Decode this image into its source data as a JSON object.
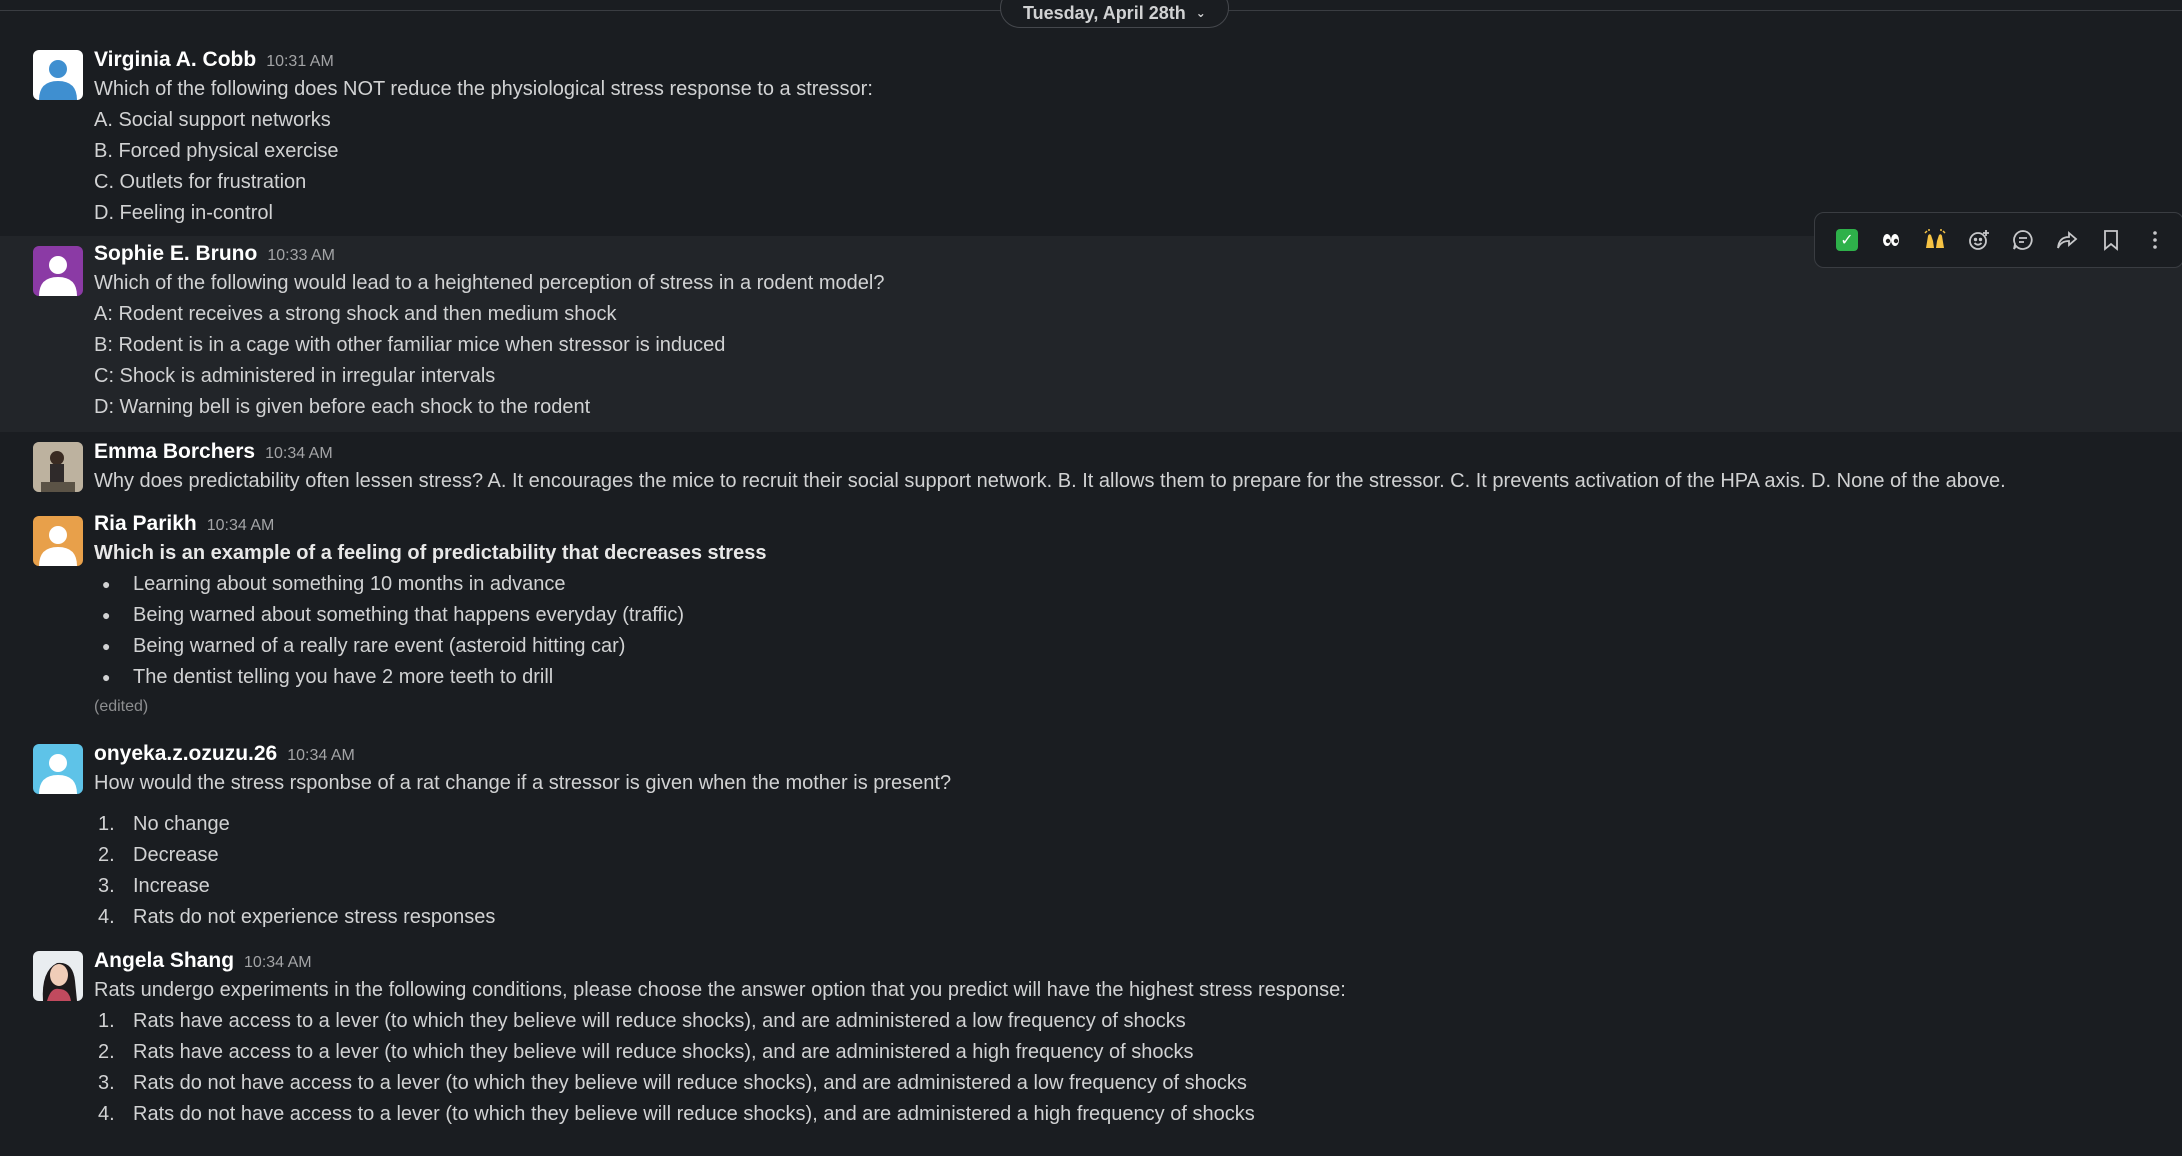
{
  "date_divider": {
    "label": "Tuesday, April 28th"
  },
  "messages": [
    {
      "author": "Virginia A. Cobb",
      "time": "10:31 AM",
      "lines": [
        "Which of the following does NOT reduce the physiological stress response to a stressor:",
        "A. Social support networks",
        "B. Forced physical exercise",
        "C. Outlets for frustration",
        "D. Feeling in-control"
      ]
    },
    {
      "author": "Sophie E. Bruno",
      "time": "10:33 AM",
      "lines": [
        "Which of the following would lead to a heightened perception of stress in a rodent model?",
        "A: Rodent receives a strong shock and then medium shock",
        "B: Rodent is in a cage with other familiar mice when stressor is induced",
        "C: Shock is administered in irregular intervals",
        "D: Warning bell is given before each shock to the rodent"
      ]
    },
    {
      "author": "Emma Borchers",
      "time": "10:34 AM",
      "lines": [
        "Why does predictability often lessen stress? A. It encourages the mice to recruit their social support network. B. It allows them to prepare for the stressor. C. It prevents activation of the HPA axis. D. None of the above."
      ]
    },
    {
      "author": "Ria Parikh",
      "time": "10:34 AM",
      "heading": "Which is an example of a feeling of predictability that decreases stress",
      "bullets": [
        "Learning about something 10 months in advance",
        "Being warned about something that happens everyday (traffic)",
        "Being warned of a really rare event (asteroid hitting car)",
        "The dentist telling you have 2 more teeth to drill"
      ],
      "edited": "(edited)"
    },
    {
      "author": "onyeka.z.ozuzu.26",
      "time": "10:34 AM",
      "lines": [
        "How would the stress rsponbse of a rat change if a stressor is given when the mother is present?"
      ],
      "items": [
        {
          "num": "1.",
          "text": "No change"
        },
        {
          "num": "2.",
          "text": "Decrease"
        },
        {
          "num": "3.",
          "text": "Increase"
        },
        {
          "num": "4.",
          "text": "Rats do not experience stress responses"
        }
      ]
    },
    {
      "author": "Angela Shang",
      "time": "10:34 AM",
      "lines": [
        "Rats undergo experiments in the following conditions, please choose the answer option that you predict will have the highest stress response:"
      ],
      "items": [
        {
          "num": "1.",
          "text": "Rats have access to a lever (to which they believe will reduce shocks), and are administered a low frequency of shocks"
        },
        {
          "num": "2.",
          "text": "Rats have access to a lever (to which they believe will reduce shocks), and are administered a high frequency of shocks"
        },
        {
          "num": "3.",
          "text": "Rats do not have access to a lever (to which they believe will reduce shocks), and are administered a low frequency of shocks"
        },
        {
          "num": "4.",
          "text": "Rats do not have access to a lever (to which they believe will reduce shocks), and are administered a high frequency of shocks"
        }
      ]
    }
  ],
  "toolbar": {
    "buttons": [
      {
        "icon": "white-check-mark-emoji",
        "glyph": "✓"
      },
      {
        "icon": "eyes-emoji",
        "glyph": "👀"
      },
      {
        "icon": "raised-hands-emoji",
        "glyph": "🙌"
      },
      {
        "icon": "add-reaction-icon"
      },
      {
        "icon": "reply-in-thread-icon"
      },
      {
        "icon": "forward-icon"
      },
      {
        "icon": "bookmark-icon"
      },
      {
        "icon": "more-actions-icon"
      }
    ]
  },
  "colors": {
    "background": "#1a1d21",
    "hover_row": "#222529",
    "text": "#d1d2d3",
    "name": "#ffffff",
    "timestamp": "#a3a4a6",
    "check_green": "#2eb14a"
  }
}
